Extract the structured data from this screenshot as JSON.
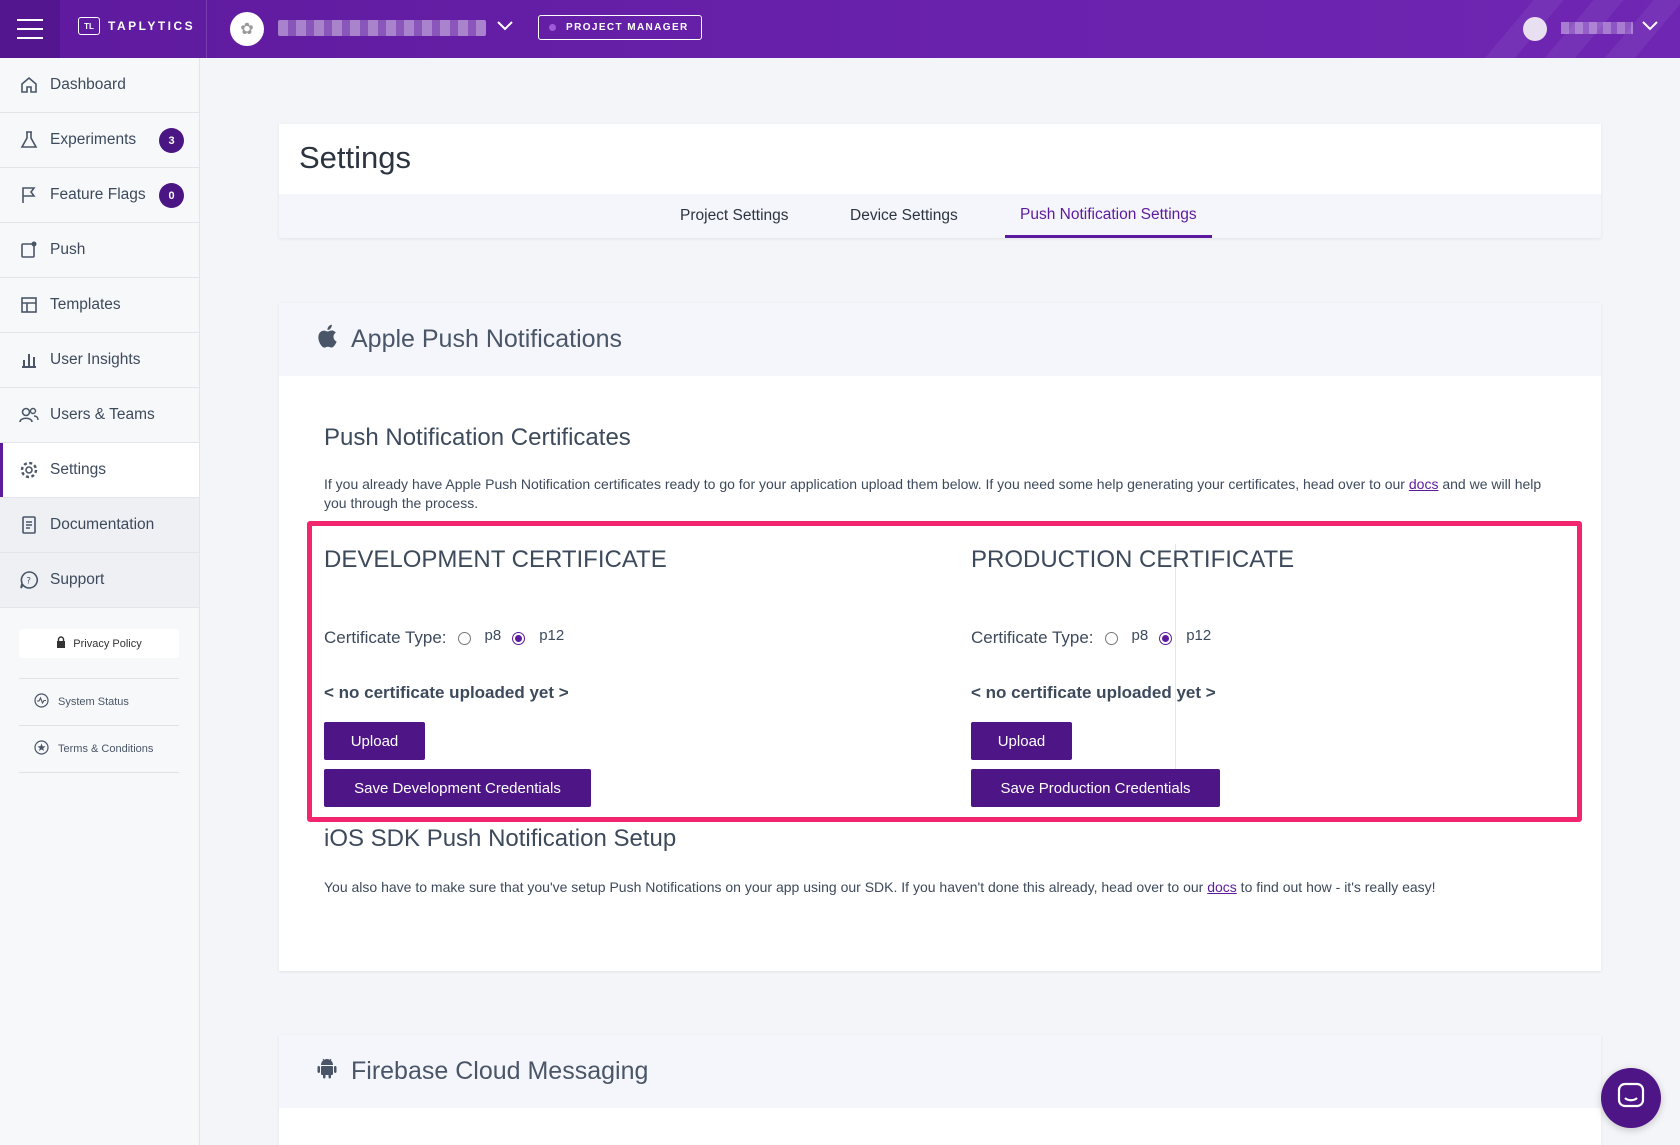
{
  "header": {
    "brand": "TAPLYTICS",
    "brand_logo": "TL",
    "badge": "PROJECT MANAGER"
  },
  "sidebar": {
    "items": [
      {
        "label": "Dashboard",
        "icon": "home-icon"
      },
      {
        "label": "Experiments",
        "icon": "flask-icon",
        "badge": "3"
      },
      {
        "label": "Feature Flags",
        "icon": "flag-icon",
        "badge": "0"
      },
      {
        "label": "Push",
        "icon": "push-icon"
      },
      {
        "label": "Templates",
        "icon": "template-icon"
      },
      {
        "label": "User Insights",
        "icon": "bar-chart-icon"
      },
      {
        "label": "Users & Teams",
        "icon": "users-icon"
      },
      {
        "label": "Settings",
        "icon": "gear-icon"
      },
      {
        "label": "Documentation",
        "icon": "document-icon"
      },
      {
        "label": "Support",
        "icon": "help-bubble-icon"
      }
    ],
    "privacy_policy": "Privacy Policy",
    "system_status": "System Status",
    "terms": "Terms & Conditions"
  },
  "settings": {
    "title": "Settings",
    "tabs": [
      "Project Settings",
      "Device Settings",
      "Push Notification Settings"
    ],
    "active_tab": "Push Notification Settings"
  },
  "apple": {
    "title": "Apple Push Notifications",
    "certs_heading": "Push Notification Certificates",
    "certs_text_1": "If you already have Apple Push Notification certificates ready to go for your application upload them below. If you need some help generating your certificates, head over to our ",
    "certs_link": "docs",
    "certs_text_2": " and we will help you through the process.",
    "development": {
      "title": "DEVELOPMENT CERTIFICATE",
      "type_label": "Certificate Type:",
      "options": [
        "p8",
        "p12"
      ],
      "selected": "p12",
      "status": "< no certificate uploaded yet >",
      "upload": "Upload",
      "save": "Save Development Credentials"
    },
    "production": {
      "title": "PRODUCTION CERTIFICATE",
      "type_label": "Certificate Type:",
      "options": [
        "p8",
        "p12"
      ],
      "selected": "p12",
      "status": "< no certificate uploaded yet >",
      "upload": "Upload",
      "save": "Save Production Credentials"
    },
    "sdk_heading": "iOS SDK Push Notification Setup",
    "sdk_text_1": "You also have to make sure that you've setup Push Notifications on your app using our SDK. If you haven't done this already, head over to our ",
    "sdk_link": "docs",
    "sdk_text_2": " to find out how - it's really easy!"
  },
  "firebase": {
    "title": "Firebase Cloud Messaging"
  },
  "colors": {
    "brand_purple": "#5e1a9e",
    "button_purple": "#4d1585",
    "highlight": "#f2256e"
  }
}
